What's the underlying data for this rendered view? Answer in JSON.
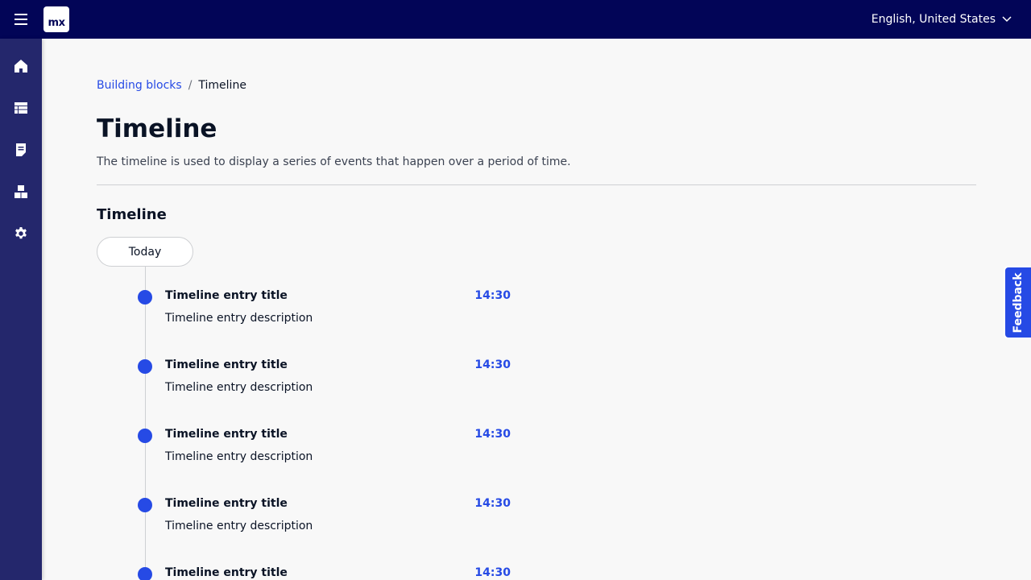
{
  "header": {
    "logo_text": "mx",
    "language": "English, United States"
  },
  "sidebar": {
    "items": [
      {
        "icon": "home-icon"
      },
      {
        "icon": "table-icon"
      },
      {
        "icon": "document-icon"
      },
      {
        "icon": "blocks-icon"
      },
      {
        "icon": "gear-icon"
      }
    ]
  },
  "breadcrumb": {
    "parent": "Building blocks",
    "separator": "/",
    "current": "Timeline"
  },
  "page": {
    "title": "Timeline",
    "description": "The timeline is used to display a series of events that happen over a period of time."
  },
  "section": {
    "title": "Timeline",
    "group_label": "Today",
    "entries": [
      {
        "title": "Timeline entry title",
        "description": "Timeline entry description",
        "time": "14:30"
      },
      {
        "title": "Timeline entry title",
        "description": "Timeline entry description",
        "time": "14:30"
      },
      {
        "title": "Timeline entry title",
        "description": "Timeline entry description",
        "time": "14:30"
      },
      {
        "title": "Timeline entry title",
        "description": "Timeline entry description",
        "time": "14:30"
      },
      {
        "title": "Timeline entry title",
        "description": "",
        "time": "14:30"
      }
    ]
  },
  "feedback": {
    "label": "Feedback"
  },
  "colors": {
    "topbar": "#020557",
    "sidebar": "#24276c",
    "accent": "#264ae5"
  }
}
